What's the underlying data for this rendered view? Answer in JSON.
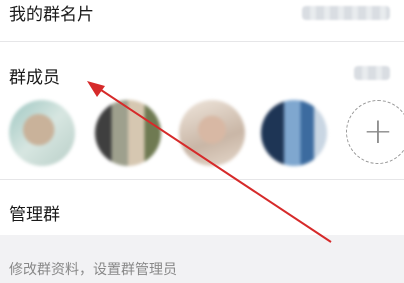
{
  "card_row": {
    "label": "我的群名片"
  },
  "members_row": {
    "label": "群成员",
    "avatars": [
      "avatar-1",
      "avatar-2",
      "avatar-3",
      "avatar-4"
    ],
    "add_icon": "plus-icon",
    "add_symbol": "+"
  },
  "manage_row": {
    "label": "管理群"
  },
  "hint": "修改群资料，设置群管理员",
  "annotation": {
    "arrow_color": "#d62a2a"
  }
}
